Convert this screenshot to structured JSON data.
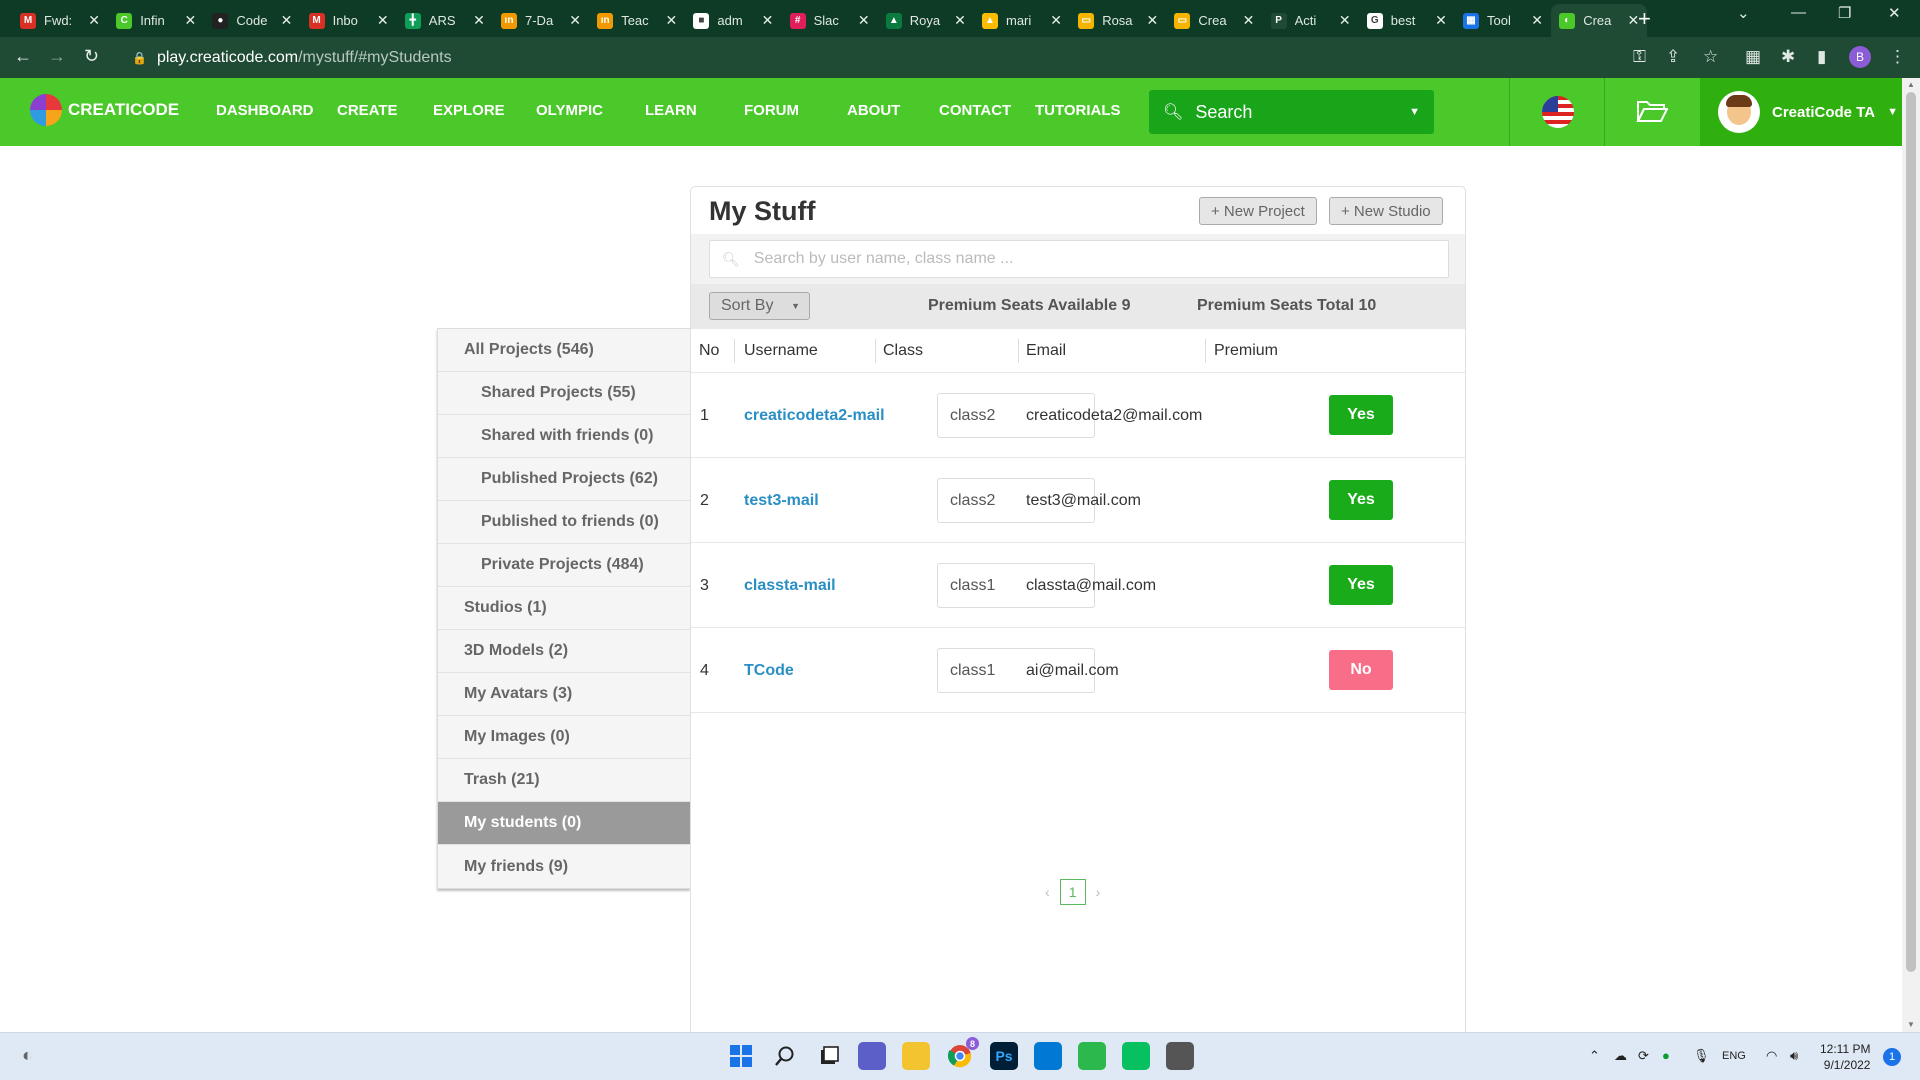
{
  "browser": {
    "tabs": [
      {
        "title": "Fwd:",
        "icon": "gmail-icon",
        "color": "#d93025",
        "glyph": "M"
      },
      {
        "title": "Infin",
        "icon": "creaticode-icon",
        "color": "#4bc82a",
        "glyph": "C"
      },
      {
        "title": "Code",
        "icon": "github-icon",
        "color": "#222222",
        "glyph": "●"
      },
      {
        "title": "Inbo",
        "icon": "gmail-icon",
        "color": "#d93025",
        "glyph": "M"
      },
      {
        "title": "ARS",
        "icon": "sheets-icon",
        "color": "#0f9d58",
        "glyph": "╋"
      },
      {
        "title": "7-Da",
        "icon": "infinite-icon",
        "color": "#f29900",
        "glyph": "ın"
      },
      {
        "title": "Teac",
        "icon": "infinite-icon",
        "color": "#f29900",
        "glyph": "ın"
      },
      {
        "title": "adm",
        "icon": "bookmark-icon",
        "color": "#ffffff",
        "glyph": "■"
      },
      {
        "title": "Slac",
        "icon": "slack-icon",
        "color": "#e01e5a",
        "glyph": "#"
      },
      {
        "title": "Roya",
        "icon": "mountain-icon",
        "color": "#0b7a3e",
        "glyph": "▲"
      },
      {
        "title": "mari",
        "icon": "drive-icon",
        "color": "#fbbc04",
        "glyph": "▲"
      },
      {
        "title": "Rosa",
        "icon": "slides-icon",
        "color": "#f4b400",
        "glyph": "▭"
      },
      {
        "title": "Crea",
        "icon": "slides-icon",
        "color": "#f4b400",
        "glyph": "▭"
      },
      {
        "title": "Acti",
        "icon": "p-icon",
        "color": "#1f4a33",
        "glyph": "P"
      },
      {
        "title": "best",
        "icon": "google-icon",
        "color": "#ffffff",
        "glyph": "G"
      },
      {
        "title": "Tool",
        "icon": "grid-icon",
        "color": "#1a73e8",
        "glyph": "▦"
      },
      {
        "title": "Crea",
        "icon": "creaticode-icon",
        "color": "#4bc82a",
        "glyph": "◐",
        "active": true
      }
    ],
    "url_host": "play.creaticode.com",
    "url_path": "/mystuff/#myStudents",
    "profile_initial": "B"
  },
  "site": {
    "brand": "CREATICODE",
    "nav": [
      "DASHBOARD",
      "CREATE",
      "EXPLORE",
      "OLYMPIC",
      "LEARN",
      "FORUM",
      "ABOUT",
      "CONTACT",
      "TUTORIALS"
    ],
    "search_placeholder": "Search",
    "username": "CreatiCode TA"
  },
  "sidebar": {
    "items": [
      {
        "label": "All Projects (546)",
        "sub": false,
        "active": false
      },
      {
        "label": "Shared Projects (55)",
        "sub": true,
        "active": false
      },
      {
        "label": "Shared with friends (0)",
        "sub": true,
        "active": false
      },
      {
        "label": "Published Projects (62)",
        "sub": true,
        "active": false
      },
      {
        "label": "Published to friends (0)",
        "sub": true,
        "active": false
      },
      {
        "label": "Private Projects (484)",
        "sub": true,
        "active": false
      },
      {
        "label": "Studios (1)",
        "sub": false,
        "active": false
      },
      {
        "label": "3D Models (2)",
        "sub": false,
        "active": false
      },
      {
        "label": "My Avatars (3)",
        "sub": false,
        "active": false
      },
      {
        "label": "My Images (0)",
        "sub": false,
        "active": false
      },
      {
        "label": "Trash (21)",
        "sub": false,
        "active": false
      },
      {
        "label": "My students (0)",
        "sub": false,
        "active": true
      },
      {
        "label": "My friends (9)",
        "sub": false,
        "active": false
      }
    ]
  },
  "panel": {
    "title": "My Stuff",
    "new_project": "+ New Project",
    "new_studio": "+ New Studio",
    "search_placeholder": "Search by user name, class name ...",
    "sort_by": "Sort By",
    "seats_available": "Premium Seats Available 9",
    "seats_total": "Premium Seats Total 10",
    "columns": [
      "No",
      "Username",
      "Class",
      "Email",
      "Premium"
    ],
    "rows": [
      {
        "no": "1",
        "username": "creaticodeta2-mail",
        "class": "class2",
        "email": "creaticodeta2@mail.com",
        "premium": "Yes"
      },
      {
        "no": "2",
        "username": "test3-mail",
        "class": "class2",
        "email": "test3@mail.com",
        "premium": "Yes"
      },
      {
        "no": "3",
        "username": "classta-mail",
        "class": "class1",
        "email": "classta@mail.com",
        "premium": "Yes"
      },
      {
        "no": "4",
        "username": "TCode",
        "class": "class1",
        "email": "ai@mail.com",
        "premium": "No"
      }
    ],
    "page": "1",
    "colors": {
      "yes": "#1aab1a",
      "no": "#f86d87"
    }
  },
  "taskbar": {
    "apps": [
      {
        "icon": "windows-start-icon",
        "color": "#1a73e8"
      },
      {
        "icon": "search-icon",
        "color": "#222222"
      },
      {
        "icon": "task-view-icon",
        "color": "#222222"
      },
      {
        "icon": "teams-chat-icon",
        "color": "#5b5fc7"
      },
      {
        "icon": "file-explorer-icon",
        "color": "#f4c430"
      },
      {
        "icon": "chrome-icon",
        "color": "#34a853"
      },
      {
        "icon": "photoshop-icon",
        "color": "#001e36",
        "glyph": "Ps"
      },
      {
        "icon": "vscode-icon",
        "color": "#0078d4"
      },
      {
        "icon": "camtasia-icon",
        "color": "#2db84d"
      },
      {
        "icon": "wechat-icon",
        "color": "#07c160"
      },
      {
        "icon": "remote-desktop-icon",
        "color": "#555555"
      }
    ],
    "lang": "ENG",
    "time": "12:11 PM",
    "date": "9/1/2022",
    "notifications": "1",
    "chrome_badge": "8"
  }
}
